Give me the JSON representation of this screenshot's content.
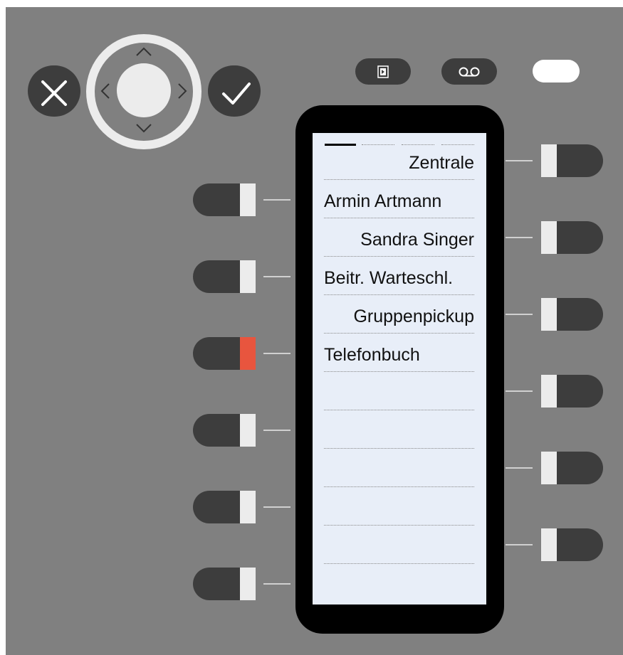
{
  "colors": {
    "panel": "#808080",
    "key": "#3d3d3d",
    "led_off": "#ececec",
    "led_active": "#e8553e",
    "screen": "#e8eef8"
  },
  "nav": {
    "cancel_icon": "close-icon",
    "confirm_icon": "check-icon"
  },
  "function_keys": [
    {
      "icon": "conference-icon"
    },
    {
      "icon": "voicemail-icon"
    },
    {
      "icon": "blank-key"
    }
  ],
  "display": {
    "rows": [
      {
        "label": "Zentrale",
        "align": "right"
      },
      {
        "label": "Armin Artmann",
        "align": "left"
      },
      {
        "label": "Sandra Singer",
        "align": "right"
      },
      {
        "label": "Beitr. Warteschl.",
        "align": "left"
      },
      {
        "label": "Gruppenpickup",
        "align": "right"
      },
      {
        "label": "Telefonbuch",
        "align": "left"
      },
      {
        "label": "",
        "align": "right"
      },
      {
        "label": "",
        "align": "left"
      },
      {
        "label": "",
        "align": "right"
      },
      {
        "label": "",
        "align": "left"
      },
      {
        "label": "",
        "align": "right"
      }
    ]
  },
  "left_keys": [
    {
      "led": "off"
    },
    {
      "led": "off"
    },
    {
      "led": "red"
    },
    {
      "led": "off"
    },
    {
      "led": "off"
    },
    {
      "led": "off"
    }
  ],
  "right_keys": [
    {
      "led": "off"
    },
    {
      "led": "off"
    },
    {
      "led": "off"
    },
    {
      "led": "off"
    },
    {
      "led": "off"
    },
    {
      "led": "off"
    }
  ]
}
